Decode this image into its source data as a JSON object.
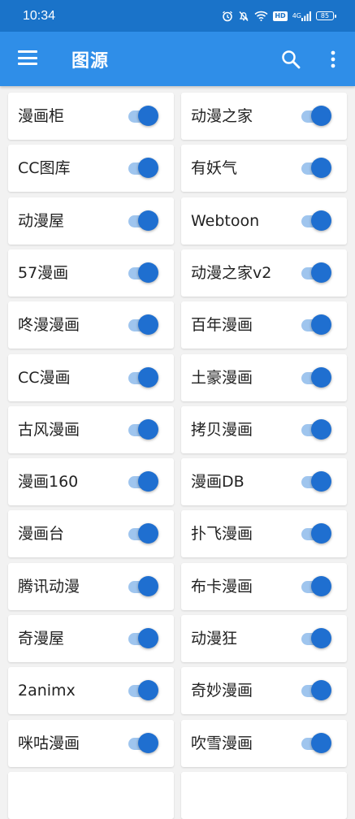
{
  "status_bar": {
    "time": "10:34",
    "hd_badge": "HD",
    "signal_text": "4G",
    "battery": "85",
    "icons": [
      "alarm-icon",
      "mute-icon",
      "wifi-icon",
      "hd-icon",
      "signal-icon",
      "battery-icon"
    ]
  },
  "app_bar": {
    "title": "图源",
    "menu_icon": "hamburger-menu-icon",
    "search_icon": "search-icon",
    "more_icon": "more-vertical-icon"
  },
  "colors": {
    "status_bar": "#1a73c9",
    "app_bar": "#2f8ee8",
    "toggle_thumb": "#1f6fd0",
    "toggle_track": "#9fc5ee",
    "background": "#f2f2f2"
  },
  "sources": [
    {
      "left": {
        "name": "漫画柜",
        "enabled": true
      },
      "right": {
        "name": "动漫之家",
        "enabled": true
      }
    },
    {
      "left": {
        "name": "CC图库",
        "enabled": true
      },
      "right": {
        "name": "有妖气",
        "enabled": true
      }
    },
    {
      "left": {
        "name": "动漫屋",
        "enabled": true
      },
      "right": {
        "name": "Webtoon",
        "enabled": true
      }
    },
    {
      "left": {
        "name": "57漫画",
        "enabled": true
      },
      "right": {
        "name": "动漫之家v2",
        "enabled": true
      }
    },
    {
      "left": {
        "name": "咚漫漫画",
        "enabled": true
      },
      "right": {
        "name": "百年漫画",
        "enabled": true
      }
    },
    {
      "left": {
        "name": "CC漫画",
        "enabled": true
      },
      "right": {
        "name": "土豪漫画",
        "enabled": true
      }
    },
    {
      "left": {
        "name": "古风漫画",
        "enabled": true
      },
      "right": {
        "name": "拷贝漫画",
        "enabled": true
      }
    },
    {
      "left": {
        "name": "漫画160",
        "enabled": true
      },
      "right": {
        "name": "漫画DB",
        "enabled": true
      }
    },
    {
      "left": {
        "name": "漫画台",
        "enabled": true
      },
      "right": {
        "name": "扑飞漫画",
        "enabled": true
      }
    },
    {
      "left": {
        "name": "腾讯动漫",
        "enabled": true
      },
      "right": {
        "name": "布卡漫画",
        "enabled": true
      }
    },
    {
      "left": {
        "name": "奇漫屋",
        "enabled": true
      },
      "right": {
        "name": "动漫狂",
        "enabled": true
      }
    },
    {
      "left": {
        "name": "2animx",
        "enabled": true
      },
      "right": {
        "name": "奇妙漫画",
        "enabled": true
      }
    },
    {
      "left": {
        "name": "咪咕漫画",
        "enabled": true
      },
      "right": {
        "name": "吹雪漫画",
        "enabled": true
      }
    }
  ]
}
